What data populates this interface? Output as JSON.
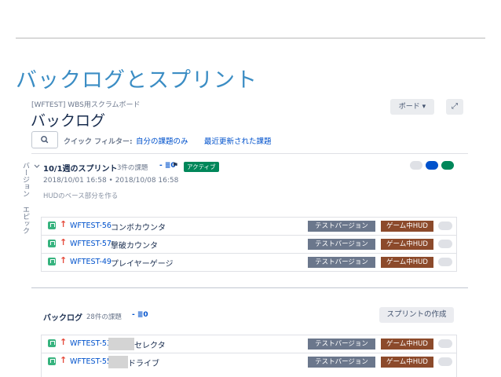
{
  "page": {
    "heading": "バックログとスプリント"
  },
  "board": {
    "breadcrumb": "[WFTEST] WBS用スクラムボード",
    "title": "バックログ",
    "board_button": "ボード ▾",
    "expand_icon": "⤢"
  },
  "filters": {
    "label": "クイック フィルター:",
    "items": [
      "自分の課題のみ",
      "最近更新された課題"
    ]
  },
  "side_tabs": [
    "バージョン",
    "エピック"
  ],
  "sprint": {
    "name": "10/1週のスプリント",
    "count": "3件の課題",
    "estimate": "-  ≣0",
    "flag": "⚑",
    "status": "アクティブ",
    "dates": "2018/10/01 16:58 • 2018/10/08 16:58",
    "goal": "HUDのベース部分を作る",
    "status_dots": [
      "#dfe1e6",
      "#0052cc",
      "#00875a"
    ],
    "issues": [
      {
        "key": "WFTEST-56",
        "summary": "コンボカウンタ",
        "labels": [
          "テストバージョン",
          "ゲーム中HUD"
        ]
      },
      {
        "key": "WFTEST-57",
        "summary": "撃破カウンタ",
        "labels": [
          "テストバージョン",
          "ゲーム中HUD"
        ]
      },
      {
        "key": "WFTEST-49",
        "summary": "プレイヤーゲージ",
        "labels": [
          "テストバージョン",
          "ゲーム中HUD"
        ]
      }
    ]
  },
  "backlog": {
    "name": "バックログ",
    "count": "28件の課題",
    "estimate": "-  ≣0",
    "create_button": "スプリントの作成",
    "issues": [
      {
        "key": "WFTEST-53",
        "summary": "セレクタ",
        "labels": [
          "テストバージョン",
          "ゲーム中HUD"
        ]
      },
      {
        "key": "WFTEST-55",
        "summary": "ドライブ",
        "labels": [
          "テストバージョン",
          "ゲーム中HUD"
        ]
      }
    ]
  },
  "colors": {
    "heading": "#3b8dc4",
    "link": "#0052cc",
    "active_badge": "#00875a",
    "label_version": "#6b778c",
    "label_hud": "#8c4a2b",
    "story": "#36b37e",
    "priority": "#e5493a"
  }
}
